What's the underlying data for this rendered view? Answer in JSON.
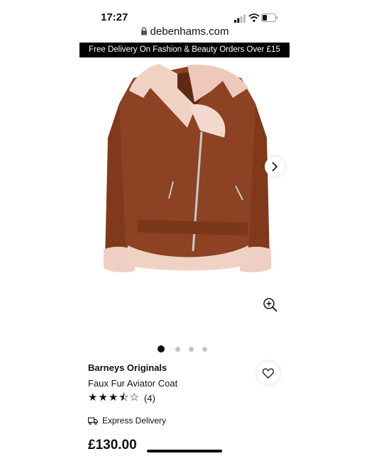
{
  "status_bar": {
    "time": "17:27"
  },
  "browser": {
    "url": "debenhams.com"
  },
  "promo_banner": {
    "text": "Free Delivery On Fashion & Beauty Orders Over £15"
  },
  "gallery": {
    "image_count": 4,
    "active_index": 0
  },
  "product": {
    "brand": "Barneys Originals",
    "name": "Faux Fur Aviator Coat",
    "rating": 3.5,
    "review_count": "(4)",
    "delivery_label": "Express Delivery",
    "price": "£130.00"
  },
  "icons": {
    "lock": "lock-icon",
    "next": "chevron-right-icon",
    "zoom": "zoom-in-icon",
    "wishlist": "heart-icon",
    "delivery": "truck-icon"
  },
  "colors": {
    "coat": "#8a3f20",
    "fur": "#f0d2c5",
    "banner_bg": "#000000",
    "star": "#111111"
  }
}
